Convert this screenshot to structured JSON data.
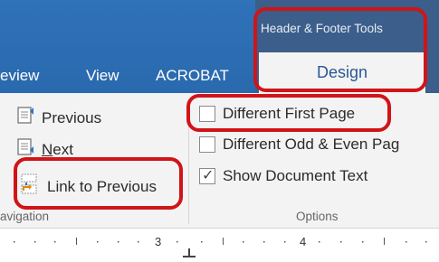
{
  "ribbon_tabs": {
    "review_partial": "eview",
    "view": "View",
    "acrobat": "ACROBAT",
    "contextual_group": "Header & Footer Tools",
    "design": "Design"
  },
  "navigation": {
    "previous": "Previous",
    "next_first": "N",
    "next_rest": "ext",
    "link_to_previous": "Link to Previous",
    "group_label_partial": "avigation"
  },
  "options": {
    "different_first_page": {
      "label": "Different First Page",
      "checked": false
    },
    "different_odd_even": {
      "label": "Different Odd & Even Pag",
      "checked": false
    },
    "show_document_text": {
      "label": "Show Document Text",
      "checked": true
    },
    "group_label": "Options"
  },
  "ruler": {
    "marks": [
      "3",
      "4"
    ]
  },
  "colors": {
    "ribbon_blue": "#2f72b9",
    "contextual_blue": "#3b5e8a",
    "highlight_red": "#d01418"
  }
}
